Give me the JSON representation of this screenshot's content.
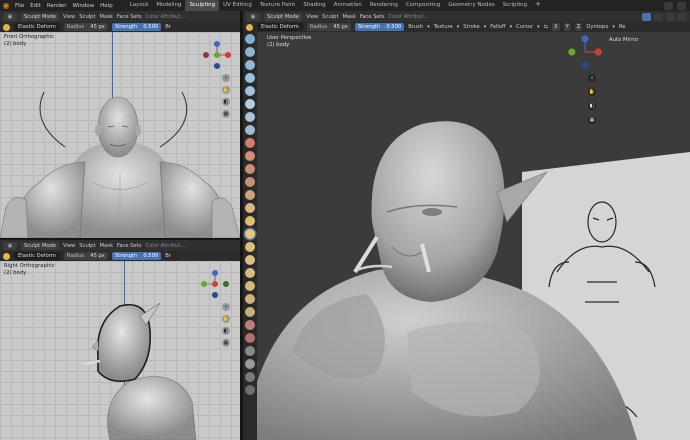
{
  "menubar": {
    "menus": [
      "File",
      "Edit",
      "Render",
      "Window",
      "Help"
    ],
    "workspaces": [
      "Layout",
      "Modeling",
      "Sculpting",
      "UV Editing",
      "Texture Paint",
      "Shading",
      "Animation",
      "Rendering",
      "Compositing",
      "Geometry Nodes",
      "Scripting"
    ],
    "active_workspace": "Sculpting",
    "add_tab": "+"
  },
  "header": {
    "mode": "Sculpt Mode",
    "view": "View",
    "sculpt": "Sculpt",
    "mask": "Mask",
    "face_sets": "Face Sets",
    "color_attribute": "Color Attribut..."
  },
  "tool_settings": {
    "brush_name": "Elastic Deform",
    "radius_label": "Radius",
    "radius_value": "45 px",
    "strength_label": "Strength",
    "strength_value": "0.500",
    "brush_menu": "Brush",
    "texture_menu": "Texture",
    "stroke_menu": "Stroke",
    "falloff_menu": "Falloff",
    "cursor_menu": "Cursor",
    "dyntopo": "Dyntopo",
    "re_truncated": "Re",
    "xyz": [
      "X",
      "Y",
      "Z"
    ],
    "truncated_right": "Br"
  },
  "viewports": {
    "top_left": {
      "projection": "Front Orthographic",
      "object": "(2) body"
    },
    "bottom_left": {
      "projection": "Right Orthographic",
      "object": "(2) body"
    },
    "main": {
      "projection": "User Perspective",
      "object": "(2) body",
      "auto_mirror": "Auto Mirror"
    }
  },
  "colors": {
    "accent_blue": "#4772b3",
    "blender_orange": "#e87d0d",
    "axis_x": "#d13b3b",
    "axis_y": "#6aa82d",
    "axis_z": "#3e68b9",
    "grid_bg": "#c9c9c9",
    "main_bg": "#3b3b3b"
  },
  "icons": [
    "blender-logo-icon",
    "search-icon",
    "zoom-icon",
    "hand-icon",
    "camera-icon",
    "grid-icon",
    "mirror-icon"
  ]
}
